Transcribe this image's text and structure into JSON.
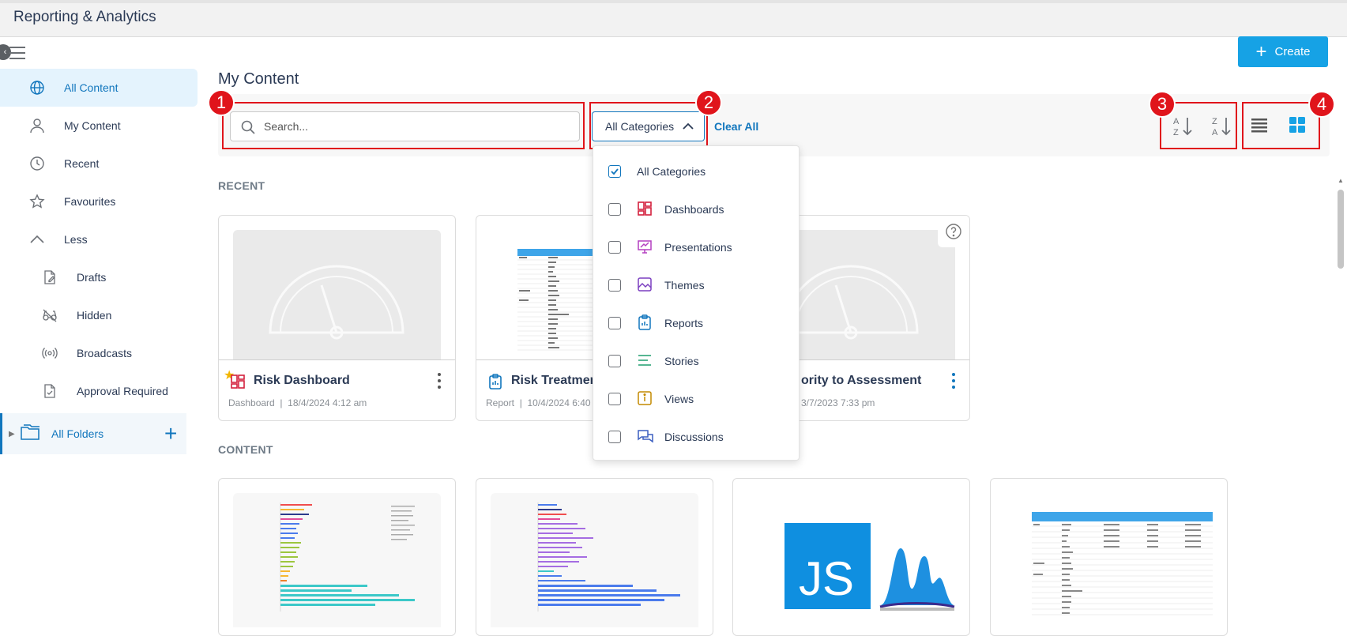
{
  "app": {
    "title": "Reporting & Analytics"
  },
  "header": {
    "create_label": "Create"
  },
  "sidebar": {
    "items": [
      {
        "label": "All Content",
        "icon": "globe-icon",
        "active": true
      },
      {
        "label": "My Content",
        "icon": "person-icon"
      },
      {
        "label": "Recent",
        "icon": "clock-icon"
      },
      {
        "label": "Favourites",
        "icon": "star-icon"
      },
      {
        "label": "Less",
        "icon": "chevron-up-icon"
      }
    ],
    "subitems": [
      {
        "label": "Drafts",
        "icon": "draft-icon"
      },
      {
        "label": "Hidden",
        "icon": "hidden-icon"
      },
      {
        "label": "Broadcasts",
        "icon": "broadcast-icon"
      },
      {
        "label": "Approval Required",
        "icon": "approval-icon"
      }
    ],
    "folders_label": "All Folders"
  },
  "main": {
    "page_title": "My Content",
    "search": {
      "placeholder": "Search..."
    },
    "category_select": {
      "value": "All Categories"
    },
    "clear_all": "Clear All",
    "recent_label": "RECENT",
    "content_label": "CONTENT"
  },
  "callouts": [
    "1",
    "2",
    "3",
    "4"
  ],
  "dropdown": {
    "items": [
      {
        "label": "All Categories",
        "checked": true
      },
      {
        "label": "Dashboards",
        "checked": false,
        "icon": "dashboard-icon",
        "color": "#d4213d"
      },
      {
        "label": "Presentations",
        "checked": false,
        "icon": "presentation-icon",
        "color": "#b43fc0"
      },
      {
        "label": "Themes",
        "checked": false,
        "icon": "theme-icon",
        "color": "#7b3fc0"
      },
      {
        "label": "Reports",
        "checked": false,
        "icon": "report-icon",
        "color": "#1176bd"
      },
      {
        "label": "Stories",
        "checked": false,
        "icon": "story-icon",
        "color": "#1f9e6e"
      },
      {
        "label": "Views",
        "checked": false,
        "icon": "view-icon",
        "color": "#c48a00"
      },
      {
        "label": "Discussions",
        "checked": false,
        "icon": "discussion-icon",
        "color": "#3c5fc0"
      }
    ]
  },
  "recent_cards": [
    {
      "title": "Risk Dashboard",
      "type": "Dashboard",
      "date": "18/4/2024 4:12 am",
      "favourite": true
    },
    {
      "title": "Risk Treatmen",
      "type": "Report",
      "date": "10/4/2024 6:40"
    },
    {
      "title": "ority to Assessment",
      "type": "",
      "date": "3/7/2023 7:33 pm"
    }
  ],
  "js_logo_text": "JS",
  "colors": {
    "accent": "#1176bd",
    "create": "#16a2e5",
    "callout": "#e0141b"
  }
}
